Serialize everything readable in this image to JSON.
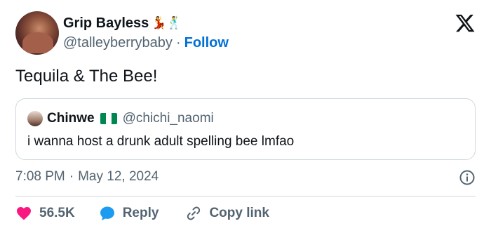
{
  "tweet": {
    "author": {
      "name": "Grip Bayless",
      "name_emojis": "💃🕺",
      "handle": "@talleyberrybaby",
      "separator": "·",
      "follow_label": "Follow"
    },
    "text": "Tequila & The Bee!",
    "quoted": {
      "name": "Chinwe",
      "handle": "@chichi_naomi",
      "text": "i wanna host a drunk adult spelling bee lmfao",
      "flag_colors": [
        "#008751",
        "#ffffff",
        "#008751"
      ]
    },
    "time": "7:08 PM",
    "date": "May 12, 2024",
    "meta_separator": "·",
    "likes": "56.5K",
    "reply_label": "Reply",
    "copy_link_label": "Copy link"
  },
  "icons": {
    "brand": "x-logo-icon",
    "info": "info-icon",
    "like": "heart-icon",
    "reply": "reply-bubble-icon",
    "copy": "link-icon"
  },
  "colors": {
    "heart": "#f91880",
    "reply_bubble": "#1d9bf0",
    "follow": "#006fd6",
    "muted": "#536471"
  }
}
